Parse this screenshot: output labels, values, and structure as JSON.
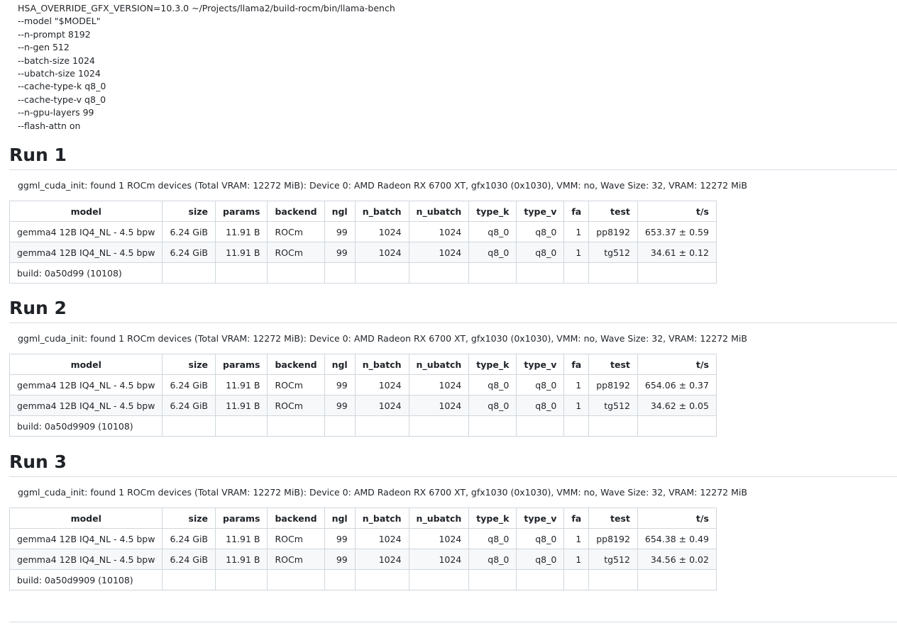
{
  "command": {
    "lines": [
      "HSA_OVERRIDE_GFX_VERSION=10.3.0 ~/Projects/llama2/build-rocm/bin/llama-bench",
      "--model \"$MODEL\"",
      "--n-prompt 8192",
      "--n-gen 512",
      "--batch-size 1024",
      "--ubatch-size 1024",
      "--cache-type-k q8_0",
      "--cache-type-v q8_0",
      "--n-gpu-layers 99",
      "--flash-attn on"
    ]
  },
  "headers": [
    "model",
    "size",
    "params",
    "backend",
    "ngl",
    "n_batch",
    "n_ubatch",
    "type_k",
    "type_v",
    "fa",
    "test",
    "t/s"
  ],
  "runs": [
    {
      "title": "Run 1",
      "init": "ggml_cuda_init: found 1 ROCm devices (Total VRAM: 12272 MiB): Device 0: AMD Radeon RX 6700 XT, gfx1030 (0x1030), VMM: no, Wave Size: 32, VRAM: 12272 MiB",
      "rows": [
        [
          "gemma4 12B IQ4_NL - 4.5 bpw",
          "6.24 GiB",
          "11.91 B",
          "ROCm",
          "99",
          "1024",
          "1024",
          "q8_0",
          "q8_0",
          "1",
          "pp8192",
          "653.37 ± 0.59"
        ],
        [
          "gemma4 12B IQ4_NL - 4.5 bpw",
          "6.24 GiB",
          "11.91 B",
          "ROCm",
          "99",
          "1024",
          "1024",
          "q8_0",
          "q8_0",
          "1",
          "tg512",
          "34.61 ± 0.12"
        ]
      ],
      "build": "build: 0a50d99 (10108)"
    },
    {
      "title": "Run 2",
      "init": "ggml_cuda_init: found 1 ROCm devices (Total VRAM: 12272 MiB): Device 0: AMD Radeon RX 6700 XT, gfx1030 (0x1030), VMM: no, Wave Size: 32, VRAM: 12272 MiB",
      "rows": [
        [
          "gemma4 12B IQ4_NL - 4.5 bpw",
          "6.24 GiB",
          "11.91 B",
          "ROCm",
          "99",
          "1024",
          "1024",
          "q8_0",
          "q8_0",
          "1",
          "pp8192",
          "654.06 ± 0.37"
        ],
        [
          "gemma4 12B IQ4_NL - 4.5 bpw",
          "6.24 GiB",
          "11.91 B",
          "ROCm",
          "99",
          "1024",
          "1024",
          "q8_0",
          "q8_0",
          "1",
          "tg512",
          "34.62 ± 0.05"
        ]
      ],
      "build": "build: 0a50d9909 (10108)"
    },
    {
      "title": "Run 3",
      "init": "ggml_cuda_init: found 1 ROCm devices (Total VRAM: 12272 MiB): Device 0: AMD Radeon RX 6700 XT, gfx1030 (0x1030), VMM: no, Wave Size: 32, VRAM: 12272 MiB",
      "rows": [
        [
          "gemma4 12B IQ4_NL - 4.5 bpw",
          "6.24 GiB",
          "11.91 B",
          "ROCm",
          "99",
          "1024",
          "1024",
          "q8_0",
          "q8_0",
          "1",
          "pp8192",
          "654.38 ± 0.49"
        ],
        [
          "gemma4 12B IQ4_NL - 4.5 bpw",
          "6.24 GiB",
          "11.91 B",
          "ROCm",
          "99",
          "1024",
          "1024",
          "q8_0",
          "q8_0",
          "1",
          "tg512",
          "34.56 ± 0.02"
        ]
      ],
      "build": "build: 0a50d9909 (10108)"
    }
  ]
}
